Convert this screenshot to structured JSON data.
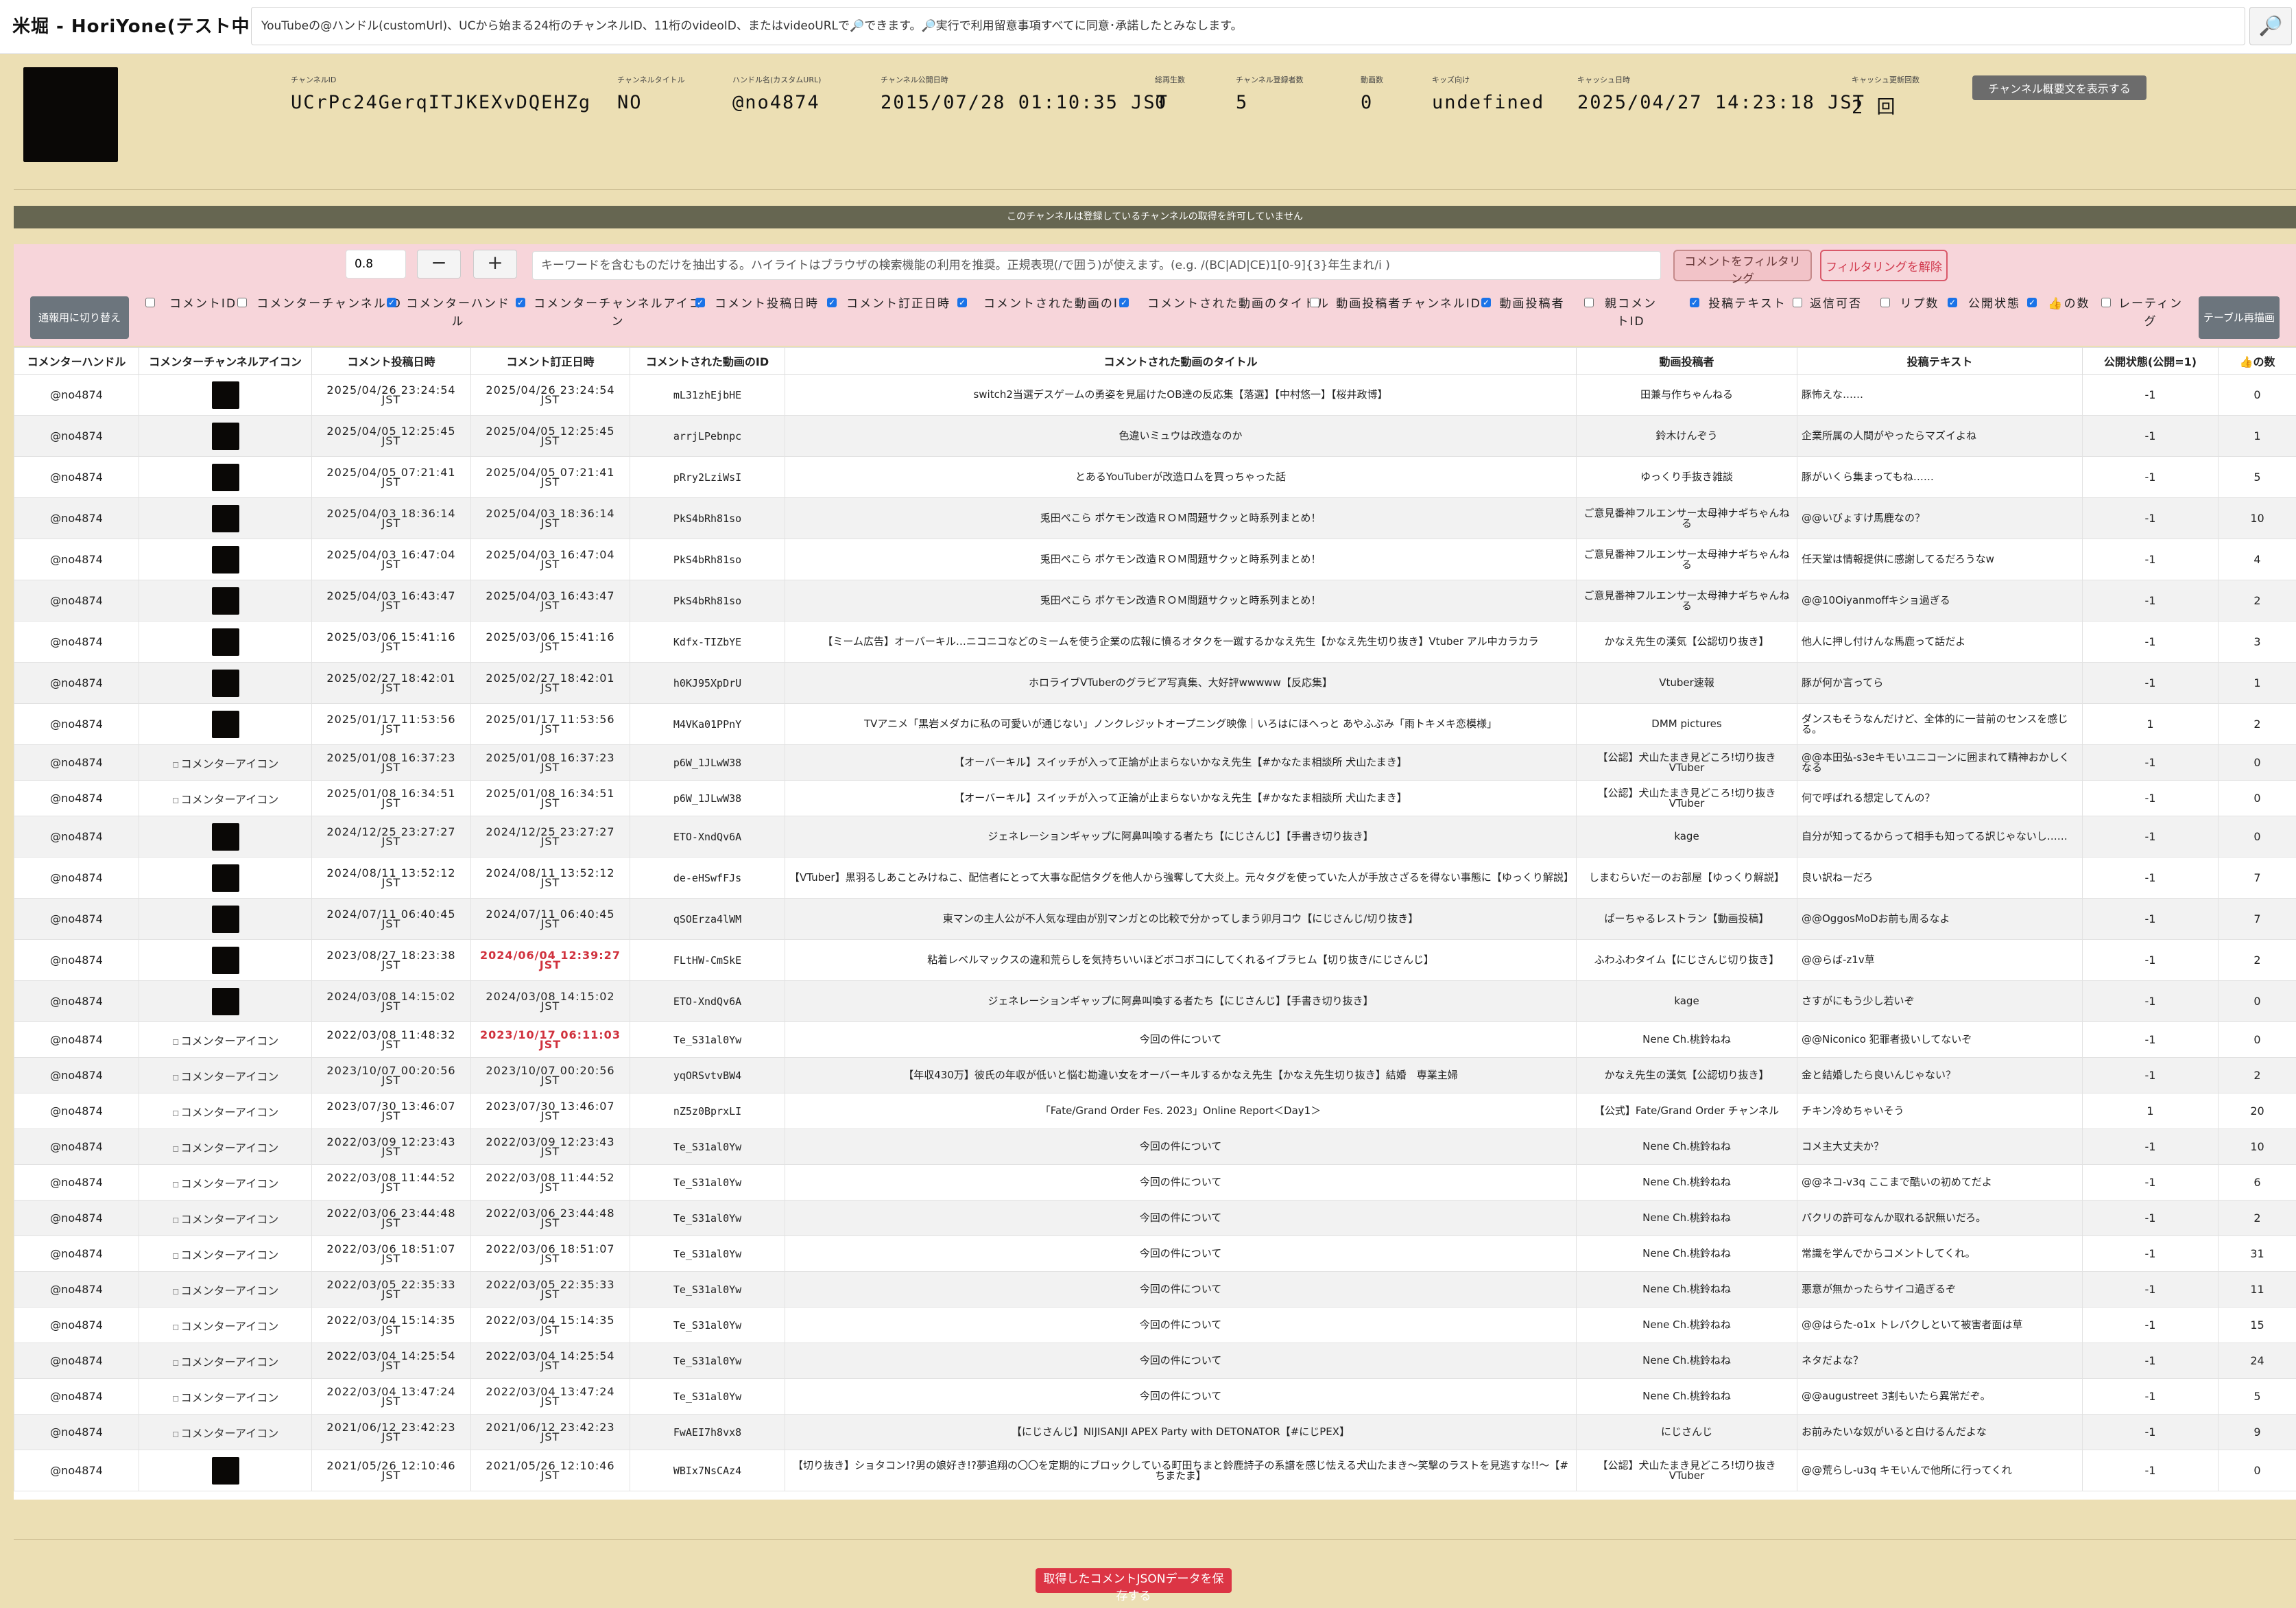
{
  "header": {
    "title": "米堀 - HoriYone(テスト中)",
    "url_placeholder": "YouTubeの@ハンドル(customUrl)、UCから始まる24桁のチャンネルID、11桁のvideoID、またはvideoURLで🔎できます。🔎実行で利用留意事項すべてに同意･承諾したとみなします。",
    "search_button": "🔎"
  },
  "channel": {
    "items": [
      {
        "label": "チャンネルID",
        "value": "UCrPc24GerqITJKEXvDQEHZg"
      },
      {
        "label": "チャンネルタイトル",
        "value": "NO"
      },
      {
        "label": "ハンドル名(カスタムURL)",
        "value": "@no4874"
      },
      {
        "label": "チャンネル公開日時",
        "value": "2015/07/28 01:10:35 JST"
      },
      {
        "label": "総再生数",
        "value": "0"
      },
      {
        "label": "チャンネル登録者数",
        "value": "5"
      },
      {
        "label": "動画数",
        "value": "0"
      },
      {
        "label": "キッズ向け",
        "value": "undefined"
      },
      {
        "label": "キャッシュ日時",
        "value": "2025/04/27 14:23:18 JST"
      },
      {
        "label": "キャッシュ更新回数",
        "value": "2 回"
      }
    ],
    "show_desc_button": "チャンネル概要文を表示する"
  },
  "notice": "このチャンネルは登録しているチャンネルの取得を許可していません",
  "filter": {
    "threshold": "0.8",
    "minus": "−",
    "plus": "+",
    "keyword_placeholder": "キーワードを含むものだけを抽出する。ハイライトはブラウザの検索機能の利用を推奨。正規表現(/で囲う)が使えます。(e.g. /(BC|AD|CE)1[0-9]{3}年生まれ/i )",
    "filter_button": "コメントをフィルタリング",
    "clear_button": "フィルタリングを解除",
    "switch_view_button": "通報用に切り替え",
    "redraw_button": "テーブル再描画",
    "columns": [
      {
        "label": "コメントID",
        "checked": false
      },
      {
        "label": "コメンターチャンネルID",
        "checked": false
      },
      {
        "label": "コメンターハンドル",
        "checked": true
      },
      {
        "label": "コメンターチャンネルアイコン",
        "checked": true
      },
      {
        "label": "コメント投稿日時",
        "checked": true
      },
      {
        "label": "コメント訂正日時",
        "checked": true
      },
      {
        "label": "コメントされた動画のID",
        "checked": true
      },
      {
        "label": "コメントされた動画のタイトル",
        "checked": true
      },
      {
        "label": "動画投稿者チャンネルID",
        "checked": false
      },
      {
        "label": "動画投稿者",
        "checked": true
      },
      {
        "label": "親コメントID",
        "checked": false
      },
      {
        "label": "投稿テキスト",
        "checked": true
      },
      {
        "label": "返信可否",
        "checked": false
      },
      {
        "label": "リプ数",
        "checked": false
      },
      {
        "label": "公開状態",
        "checked": true
      },
      {
        "label": "👍の数",
        "checked": true
      },
      {
        "label": "レーティング",
        "checked": false
      }
    ]
  },
  "table": {
    "headers": [
      "コメンターハンドル",
      "コメンターチャンネルアイコン",
      "コメント投稿日時",
      "コメント訂正日時",
      "コメントされた動画のID",
      "コメントされた動画のタイトル",
      "動画投稿者",
      "投稿テキスト",
      "公開状態(公開=1)",
      "👍の数"
    ],
    "icon_alt": "コメンターアイコン",
    "rows": [
      {
        "handle": "@no4874",
        "icon": "img",
        "posted": "2025/04/26 23:24:54 JST",
        "edited": "2025/04/26 23:24:54 JST",
        "edited_red": false,
        "vid": "mL31zhEjbHE",
        "title": "switch2当選デスゲームの勇姿を見届けたOB達の反応集【落選】【中村悠一】【桜井政博】",
        "uploader": "田兼与作ちゃんねる",
        "text": "豚怖えな……",
        "status": "-1",
        "likes": "0"
      },
      {
        "handle": "@no4874",
        "icon": "img",
        "posted": "2025/04/05 12:25:45 JST",
        "edited": "2025/04/05 12:25:45 JST",
        "edited_red": false,
        "vid": "arrjLPebnpc",
        "title": "色違いミュウは改造なのか",
        "uploader": "鈴木けんぞう",
        "text": "企業所属の人間がやったらマズイよね",
        "status": "-1",
        "likes": "1"
      },
      {
        "handle": "@no4874",
        "icon": "img",
        "posted": "2025/04/05 07:21:41 JST",
        "edited": "2025/04/05 07:21:41 JST",
        "edited_red": false,
        "vid": "pRry2LziWsI",
        "title": "とあるYouTuberが改造ロムを買っちゃった話",
        "uploader": "ゆっくり手抜き雑談",
        "text": "豚がいくら集まってもね……",
        "status": "-1",
        "likes": "5"
      },
      {
        "handle": "@no4874",
        "icon": "img",
        "posted": "2025/04/03 18:36:14 JST",
        "edited": "2025/04/03 18:36:14 JST",
        "edited_red": false,
        "vid": "PkS4bRh81so",
        "title": "兎田ぺこら ポケモン改造ＲＯＭ問題サクッと時系列まとめ！",
        "uploader": "ご意見番神フルエンサー太母神ナギちゃんねる",
        "text": "@@いびょすけ馬鹿なの？",
        "status": "-1",
        "likes": "10"
      },
      {
        "handle": "@no4874",
        "icon": "img",
        "posted": "2025/04/03 16:47:04 JST",
        "edited": "2025/04/03 16:47:04 JST",
        "edited_red": false,
        "vid": "PkS4bRh81so",
        "title": "兎田ぺこら ポケモン改造ＲＯＭ問題サクッと時系列まとめ！",
        "uploader": "ご意見番神フルエンサー太母神ナギちゃんねる",
        "text": "任天堂は情報提供に感謝してるだろうなw",
        "status": "-1",
        "likes": "4"
      },
      {
        "handle": "@no4874",
        "icon": "img",
        "posted": "2025/04/03 16:43:47 JST",
        "edited": "2025/04/03 16:43:47 JST",
        "edited_red": false,
        "vid": "PkS4bRh81so",
        "title": "兎田ぺこら ポケモン改造ＲＯＭ問題サクッと時系列まとめ！",
        "uploader": "ご意見番神フルエンサー太母神ナギちゃんねる",
        "text": "@@10Oiyanmoffキショ過ぎる",
        "status": "-1",
        "likes": "2"
      },
      {
        "handle": "@no4874",
        "icon": "img",
        "posted": "2025/03/06 15:41:16 JST",
        "edited": "2025/03/06 15:41:16 JST",
        "edited_red": false,
        "vid": "Kdfx-TIZbYE",
        "title": "【ミーム広告】オーバーキル…ニコニコなどのミームを使う企業の広報に憤るオタクを一蹴するかなえ先生【かなえ先生切り抜き】Vtuber アル中カラカラ",
        "uploader": "かなえ先生の漢気【公認切り抜き】",
        "text": "他人に押し付けんな馬鹿って話だよ",
        "status": "-1",
        "likes": "3"
      },
      {
        "handle": "@no4874",
        "icon": "img",
        "posted": "2025/02/27 18:42:01 JST",
        "edited": "2025/02/27 18:42:01 JST",
        "edited_red": false,
        "vid": "h0KJ95XpDrU",
        "title": "ホロライブVTuberのグラビア写真集、大好評wwwww【反応集】",
        "uploader": "Vtuber速報",
        "text": "豚が何か言ってら",
        "status": "-1",
        "likes": "1"
      },
      {
        "handle": "@no4874",
        "icon": "img",
        "posted": "2025/01/17 11:53:56 JST",
        "edited": "2025/01/17 11:53:56 JST",
        "edited_red": false,
        "vid": "M4VKa01PPnY",
        "title": "TVアニメ「黒岩メダカに私の可愛いが通じない」ノンクレジットオープニング映像｜いろはにほへっと あやふぶみ「雨トキメキ恋模様」",
        "uploader": "DMM pictures",
        "text": "ダンスもそうなんだけど、全体的に一昔前のセンスを感じる。",
        "status": "1",
        "likes": "2"
      },
      {
        "handle": "@no4874",
        "icon": "alt",
        "posted": "2025/01/08 16:37:23 JST",
        "edited": "2025/01/08 16:37:23 JST",
        "edited_red": false,
        "vid": "p6W_1JLwW38",
        "title": "【オーバーキル】スイッチが入って正論が止まらないかなえ先生【#かなたま相談所 犬山たまき】",
        "uploader": "【公認】犬山たまき見どころ!切り抜きVTuber",
        "text": "@@本田弘-s3eキモいユニコーンに囲まれて精神おかしくなる",
        "status": "-1",
        "likes": "0"
      },
      {
        "handle": "@no4874",
        "icon": "alt",
        "posted": "2025/01/08 16:34:51 JST",
        "edited": "2025/01/08 16:34:51 JST",
        "edited_red": false,
        "vid": "p6W_1JLwW38",
        "title": "【オーバーキル】スイッチが入って正論が止まらないかなえ先生【#かなたま相談所 犬山たまき】",
        "uploader": "【公認】犬山たまき見どころ!切り抜きVTuber",
        "text": "何で呼ばれる想定してんの？",
        "status": "-1",
        "likes": "0"
      },
      {
        "handle": "@no4874",
        "icon": "img",
        "posted": "2024/12/25 23:27:27 JST",
        "edited": "2024/12/25 23:27:27 JST",
        "edited_red": false,
        "vid": "ETO-XndQv6A",
        "title": "ジェネレーションギャップに阿鼻叫喚する者たち【にじさんじ】【手書き切り抜き】",
        "uploader": "kage",
        "text": "自分が知ってるからって相手も知ってる訳じゃないし……",
        "status": "-1",
        "likes": "0"
      },
      {
        "handle": "@no4874",
        "icon": "img",
        "posted": "2024/08/11 13:52:12 JST",
        "edited": "2024/08/11 13:52:12 JST",
        "edited_red": false,
        "vid": "de-eHSwfFJs",
        "title": "【VTuber】黒羽るしあことみけねこ、配信者にとって大事な配信タグを他人から強奪して大炎上。元々タグを使っていた人が手放さざるを得ない事態に【ゆっくり解説】",
        "uploader": "しまむらいだーのお部屋【ゆっくり解説】",
        "text": "良い訳ねーだろ",
        "status": "-1",
        "likes": "7"
      },
      {
        "handle": "@no4874",
        "icon": "img",
        "posted": "2024/07/11 06:40:45 JST",
        "edited": "2024/07/11 06:40:45 JST",
        "edited_red": false,
        "vid": "qSOErza4lWM",
        "title": "東マンの主人公が不人気な理由が別マンガとの比較で分かってしまう卯月コウ【にじさんじ/切り抜き】",
        "uploader": "ぱーちゃるレストラン【動画投稿】",
        "text": "@@OggosMoDお前も周るなよ",
        "status": "-1",
        "likes": "7"
      },
      {
        "handle": "@no4874",
        "icon": "img",
        "posted": "2023/08/27 18:23:38 JST",
        "edited": "2024/06/04 12:39:27 JST",
        "edited_red": true,
        "vid": "FLtHW-CmSkE",
        "title": "粘着レベルマックスの違和荒らしを気持ちいいほどボコボコにしてくれるイブラヒム【切り抜き/にじさんじ】",
        "uploader": "ふわふわタイム【にじさんじ切り抜き】",
        "text": "@@らば-z1v草",
        "status": "-1",
        "likes": "2"
      },
      {
        "handle": "@no4874",
        "icon": "img",
        "posted": "2024/03/08 14:15:02 JST",
        "edited": "2024/03/08 14:15:02 JST",
        "edited_red": false,
        "vid": "ETO-XndQv6A",
        "title": "ジェネレーションギャップに阿鼻叫喚する者たち【にじさんじ】【手書き切り抜き】",
        "uploader": "kage",
        "text": "さすがにもう少し若いぞ",
        "status": "-1",
        "likes": "0"
      },
      {
        "handle": "@no4874",
        "icon": "alt",
        "posted": "2022/03/08 11:48:32 JST",
        "edited": "2023/10/17 06:11:03 JST",
        "edited_red": true,
        "vid": "Te_S31al0Yw",
        "title": "今回の件について",
        "uploader": "Nene Ch.桃鈴ねね",
        "text": "@@Niconico 犯罪者扱いしてないぞ",
        "status": "-1",
        "likes": "0"
      },
      {
        "handle": "@no4874",
        "icon": "alt",
        "posted": "2023/10/07 00:20:56 JST",
        "edited": "2023/10/07 00:20:56 JST",
        "edited_red": false,
        "vid": "yqORSvtvBW4",
        "title": "【年収430万】彼氏の年収が低いと悩む勘違い女をオーバーキルするかなえ先生【かなえ先生切り抜き】結婚　専業主婦",
        "uploader": "かなえ先生の漢気【公認切り抜き】",
        "text": "金と結婚したら良いんじゃない？",
        "status": "-1",
        "likes": "2"
      },
      {
        "handle": "@no4874",
        "icon": "alt",
        "posted": "2023/07/30 13:46:07 JST",
        "edited": "2023/07/30 13:46:07 JST",
        "edited_red": false,
        "vid": "nZ5z0BprxLI",
        "title": "「Fate/Grand Order Fes. 2023」Online Report＜Day1＞",
        "uploader": "【公式】Fate/Grand Order チャンネル",
        "text": "チキン冷めちゃいそう",
        "status": "1",
        "likes": "20"
      },
      {
        "handle": "@no4874",
        "icon": "alt",
        "posted": "2022/03/09 12:23:43 JST",
        "edited": "2022/03/09 12:23:43 JST",
        "edited_red": false,
        "vid": "Te_S31al0Yw",
        "title": "今回の件について",
        "uploader": "Nene Ch.桃鈴ねね",
        "text": "コメ主大丈夫か？",
        "status": "-1",
        "likes": "10"
      },
      {
        "handle": "@no4874",
        "icon": "alt",
        "posted": "2022/03/08 11:44:52 JST",
        "edited": "2022/03/08 11:44:52 JST",
        "edited_red": false,
        "vid": "Te_S31al0Yw",
        "title": "今回の件について",
        "uploader": "Nene Ch.桃鈴ねね",
        "text": "@@ネコ-v3q ここまで酷いの初めてだよ",
        "status": "-1",
        "likes": "6"
      },
      {
        "handle": "@no4874",
        "icon": "alt",
        "posted": "2022/03/06 23:44:48 JST",
        "edited": "2022/03/06 23:44:48 JST",
        "edited_red": false,
        "vid": "Te_S31al0Yw",
        "title": "今回の件について",
        "uploader": "Nene Ch.桃鈴ねね",
        "text": "パクリの許可なんか取れる訳無いだろ。",
        "status": "-1",
        "likes": "2"
      },
      {
        "handle": "@no4874",
        "icon": "alt",
        "posted": "2022/03/06 18:51:07 JST",
        "edited": "2022/03/06 18:51:07 JST",
        "edited_red": false,
        "vid": "Te_S31al0Yw",
        "title": "今回の件について",
        "uploader": "Nene Ch.桃鈴ねね",
        "text": "常識を学んでからコメントしてくれ。",
        "status": "-1",
        "likes": "31"
      },
      {
        "handle": "@no4874",
        "icon": "alt",
        "posted": "2022/03/05 22:35:33 JST",
        "edited": "2022/03/05 22:35:33 JST",
        "edited_red": false,
        "vid": "Te_S31al0Yw",
        "title": "今回の件について",
        "uploader": "Nene Ch.桃鈴ねね",
        "text": "悪意が無かったらサイコ過ぎるぞ",
        "status": "-1",
        "likes": "11"
      },
      {
        "handle": "@no4874",
        "icon": "alt",
        "posted": "2022/03/04 15:14:35 JST",
        "edited": "2022/03/04 15:14:35 JST",
        "edited_red": false,
        "vid": "Te_S31al0Yw",
        "title": "今回の件について",
        "uploader": "Nene Ch.桃鈴ねね",
        "text": "@@はらた-o1x トレパクしといて被害者面は草",
        "status": "-1",
        "likes": "15"
      },
      {
        "handle": "@no4874",
        "icon": "alt",
        "posted": "2022/03/04 14:25:54 JST",
        "edited": "2022/03/04 14:25:54 JST",
        "edited_red": false,
        "vid": "Te_S31al0Yw",
        "title": "今回の件について",
        "uploader": "Nene Ch.桃鈴ねね",
        "text": "ネタだよな？",
        "status": "-1",
        "likes": "24"
      },
      {
        "handle": "@no4874",
        "icon": "alt",
        "posted": "2022/03/04 13:47:24 JST",
        "edited": "2022/03/04 13:47:24 JST",
        "edited_red": false,
        "vid": "Te_S31al0Yw",
        "title": "今回の件について",
        "uploader": "Nene Ch.桃鈴ねね",
        "text": "@@augustreet 3割もいたら異常だぞ。",
        "status": "-1",
        "likes": "5"
      },
      {
        "handle": "@no4874",
        "icon": "alt",
        "posted": "2021/06/12 23:42:23 JST",
        "edited": "2021/06/12 23:42:23 JST",
        "edited_red": false,
        "vid": "FwAEI7h8vx8",
        "title": "【にじさんじ】NIJISANJI APEX Party with DETONATOR【#にじPEX】",
        "uploader": "にじさんじ",
        "text": "お前みたいな奴がいると白けるんだよな",
        "status": "-1",
        "likes": "9"
      },
      {
        "handle": "@no4874",
        "icon": "img",
        "posted": "2021/05/26 12:10:46 JST",
        "edited": "2021/05/26 12:10:46 JST",
        "edited_red": false,
        "vid": "WBIx7NsCAz4",
        "title": "【切り抜き】ショタコン!?男の娘好き!?夢追翔の〇〇を定期的にブロックしている町田ちまと鈴鹿詩子の系譜を感じ怯える犬山たまき～笑撃のラストを見逃すな!!～【#ちまたま】",
        "uploader": "【公認】犬山たまき見どころ!切り抜きVTuber",
        "text": "@@荒らし-u3q キモいんで他所に行ってくれ",
        "status": "-1",
        "likes": "0"
      }
    ]
  },
  "footer": {
    "save_button": "取得したコメントJSONデータを保存する"
  }
}
